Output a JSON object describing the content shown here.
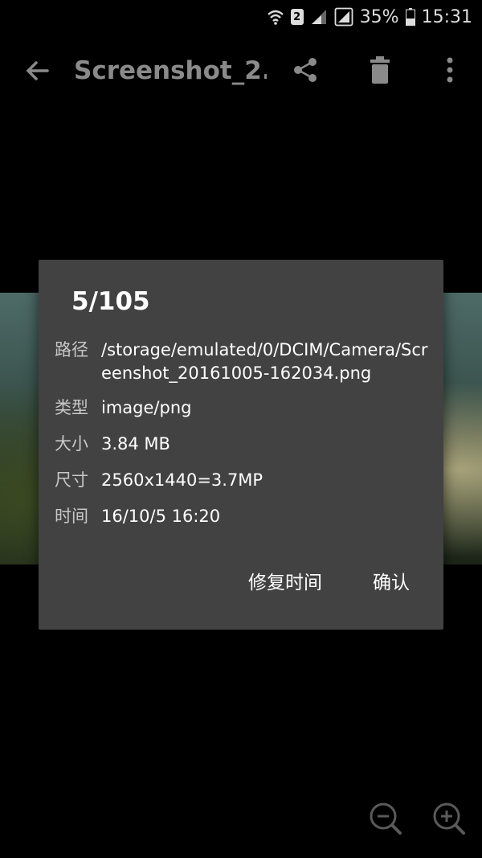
{
  "status_bar": {
    "sim_slot": "2",
    "battery_percent": "35%",
    "time": "15:31"
  },
  "app_bar": {
    "title": "Screenshot_2..."
  },
  "dialog": {
    "title": "5/105",
    "rows": [
      {
        "label": "路径",
        "value": "/storage/emulated/0/DCIM/Camera/Screenshot_20161005-162034.png"
      },
      {
        "label": "类型",
        "value": "image/png"
      },
      {
        "label": "大小",
        "value": "3.84 MB"
      },
      {
        "label": "尺寸",
        "value": "2560x1440=3.7MP"
      },
      {
        "label": "时间",
        "value": "16/10/5 16:20"
      }
    ],
    "buttons": {
      "fix_time": "修复时间",
      "confirm": "确认"
    }
  },
  "icons": {
    "back": "arrow-back-icon",
    "share": "share-icon",
    "delete": "trash-icon",
    "more": "more-vert-icon",
    "zoom_out": "zoom-out-icon",
    "zoom_in": "zoom-in-icon"
  }
}
